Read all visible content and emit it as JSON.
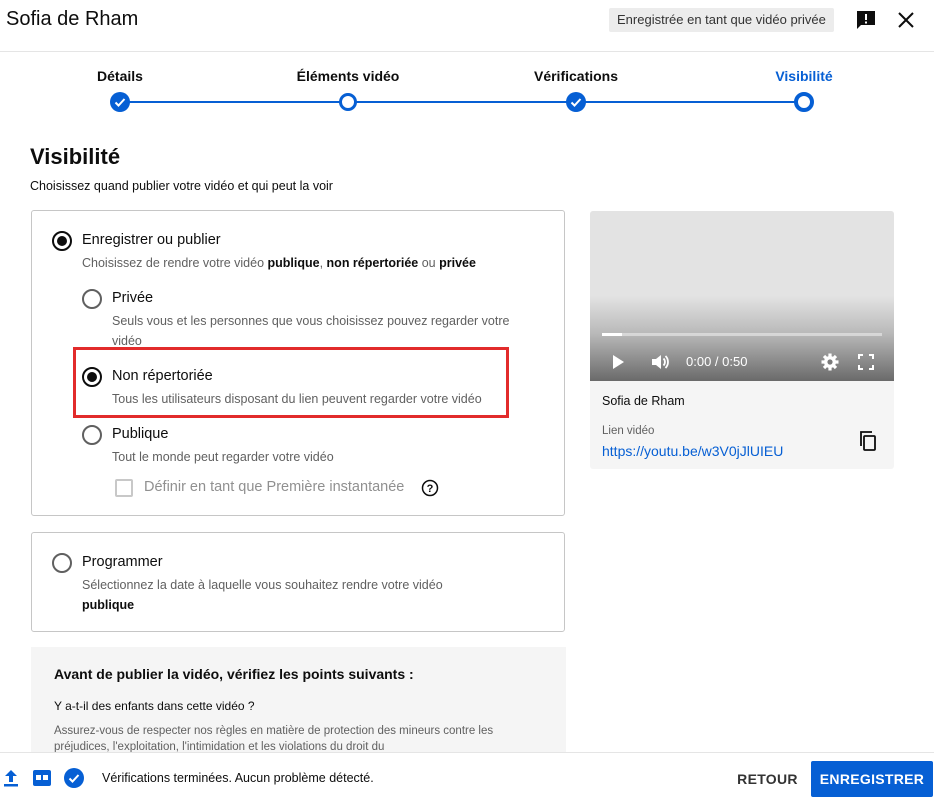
{
  "header": {
    "title": "Sofia de Rham",
    "status_chip": "Enregistrée en tant que vidéo privée"
  },
  "stepper": {
    "steps": [
      {
        "label": "Détails",
        "state": "done"
      },
      {
        "label": "Éléments vidéo",
        "state": "visited"
      },
      {
        "label": "Vérifications",
        "state": "done"
      },
      {
        "label": "Visibilité",
        "state": "current"
      }
    ]
  },
  "main": {
    "title": "Visibilité",
    "subtitle": "Choisissez quand publier votre vidéo et qui peut la voir",
    "save_publish": {
      "title": "Enregistrer ou publier",
      "desc_prefix": "Choisissez de rendre votre vidéo ",
      "desc_public": "publique",
      "desc_sep": ", ",
      "desc_unlisted": "non répertoriée",
      "desc_or": " ou ",
      "desc_private": "privée",
      "options": [
        {
          "title": "Privée",
          "desc": "Seuls vous et les personnes que vous choisissez pouvez regarder votre vidéo",
          "checked": false
        },
        {
          "title": "Non répertoriée",
          "desc": "Tous les utilisateurs disposant du lien peuvent regarder votre vidéo",
          "checked": true
        },
        {
          "title": "Publique",
          "desc": "Tout le monde peut regarder votre vidéo",
          "checked": false
        }
      ],
      "premiere_label": "Définir en tant que Première instantanée"
    },
    "schedule": {
      "title": "Programmer",
      "desc": "Sélectionnez la date à laquelle vous souhaitez rendre votre vidéo",
      "desc_bold": "publique"
    },
    "checklist": {
      "title": "Avant de publier la vidéo, vérifiez les points suivants :",
      "question": "Y a-t-il des enfants dans cette vidéo ?",
      "text": "Assurez-vous de respecter nos règles en matière de protection des mineurs contre les préjudices, l'exploitation, l'intimidation et les violations du droit du"
    }
  },
  "preview": {
    "time": "0:00 / 0:50",
    "progress": 0.07,
    "title": "Sofia de Rham",
    "link_label": "Lien vidéo",
    "link_url": "https://youtu.be/w3V0jJlUIEU"
  },
  "footer": {
    "status": "Vérifications terminées. Aucun problème détecté.",
    "back_label": "RETOUR",
    "save_label": "ENREGISTRER"
  },
  "colors": {
    "accent": "#065fd4",
    "highlight": "#e22b2b"
  }
}
